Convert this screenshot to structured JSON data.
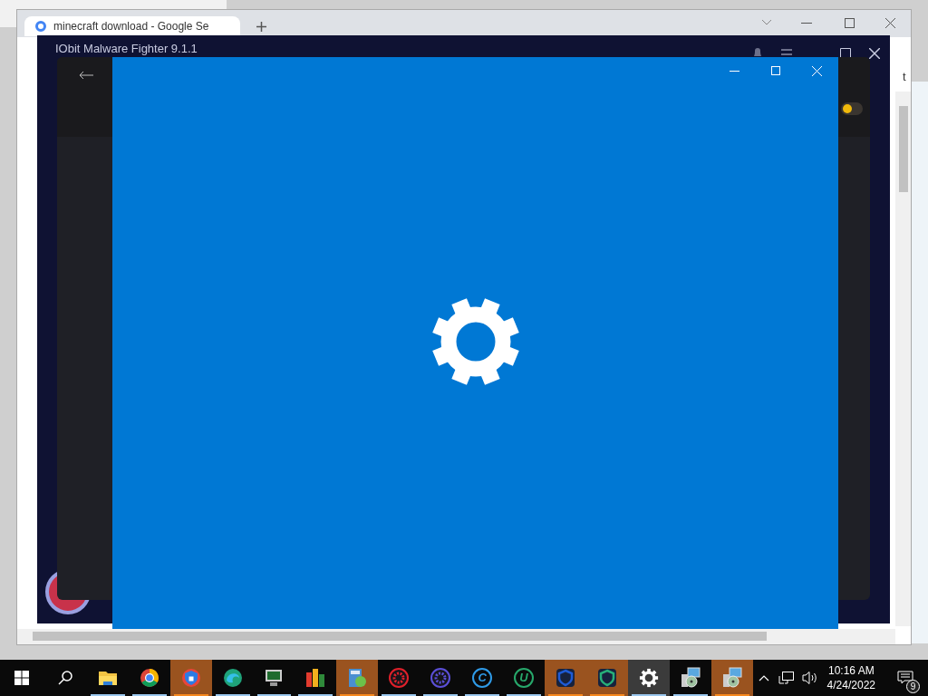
{
  "browser": {
    "tab": {
      "title": "minecraft download - Google Se"
    },
    "edge_text": "t"
  },
  "malware_app": {
    "title": "IObit Malware Fighter 9.1.1",
    "toggle": {
      "on": false
    }
  },
  "taskbar": {
    "apps": [
      {
        "kind": "folder",
        "running": true,
        "flashing": false,
        "selected": false
      },
      {
        "kind": "ring",
        "running": true,
        "flashing": false,
        "selected": false
      },
      {
        "kind": "shield-lock",
        "running": true,
        "flashing": true,
        "selected": false
      },
      {
        "kind": "swirl",
        "running": true,
        "flashing": false,
        "selected": false
      },
      {
        "kind": "monitor",
        "running": true,
        "flashing": false,
        "selected": false
      },
      {
        "kind": "blocks",
        "running": true,
        "flashing": false,
        "selected": false
      },
      {
        "kind": "box",
        "running": true,
        "flashing": true,
        "selected": false
      },
      {
        "kind": "cog-circle",
        "running": true,
        "flashing": false,
        "selected": false,
        "color": "#e0202a"
      },
      {
        "kind": "cog-circle",
        "running": true,
        "flashing": false,
        "selected": false,
        "color": "#5b4fd8"
      },
      {
        "kind": "letter",
        "glyph": "C",
        "running": true,
        "flashing": false,
        "selected": false,
        "color": "#2f9be8"
      },
      {
        "kind": "letter",
        "glyph": "U",
        "running": true,
        "flashing": false,
        "selected": false,
        "color": "#27a86b"
      },
      {
        "kind": "shield",
        "running": true,
        "flashing": true,
        "selected": false,
        "color": "#1e5bd6"
      },
      {
        "kind": "shield",
        "running": true,
        "flashing": true,
        "selected": false,
        "color": "#27b07a"
      },
      {
        "kind": "gear",
        "running": true,
        "flashing": false,
        "selected": true
      },
      {
        "kind": "installer",
        "running": true,
        "flashing": false,
        "selected": false
      },
      {
        "kind": "installer",
        "running": true,
        "flashing": true,
        "selected": false
      }
    ],
    "clock": {
      "time": "10:16 AM",
      "date": "4/24/2022"
    },
    "notifications": {
      "count": "9"
    }
  }
}
